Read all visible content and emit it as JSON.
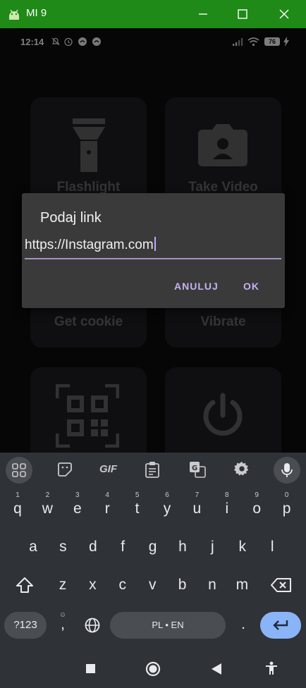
{
  "window": {
    "title": "MI 9"
  },
  "status": {
    "time": "12:14",
    "battery": "76"
  },
  "tiles": [
    {
      "label": "Flashlight",
      "icon": "flashlight-icon"
    },
    {
      "label": "Take Video",
      "icon": "camera-icon"
    },
    {
      "label": "Get cookie",
      "icon": "cookie-icon"
    },
    {
      "label": "Vibrate",
      "icon": "vibrate-icon"
    },
    {
      "label": "QR",
      "icon": "qr-code-icon"
    },
    {
      "label": "Turn off",
      "icon": "power-icon"
    }
  ],
  "dialog": {
    "title": "Podaj link",
    "input_value": "https://Instagram.com",
    "cancel_label": "ANULUJ",
    "ok_label": "OK"
  },
  "keyboard": {
    "toolbar": [
      "apps-grid-icon",
      "sticker-icon",
      "GIF",
      "clipboard-icon",
      "translate-icon",
      "gear-icon",
      "mic-icon"
    ],
    "row1": [
      {
        "k": "q",
        "h": "1"
      },
      {
        "k": "w",
        "h": "2"
      },
      {
        "k": "e",
        "h": "3"
      },
      {
        "k": "r",
        "h": "4"
      },
      {
        "k": "t",
        "h": "5"
      },
      {
        "k": "y",
        "h": "6"
      },
      {
        "k": "u",
        "h": "7"
      },
      {
        "k": "i",
        "h": "8"
      },
      {
        "k": "o",
        "h": "9"
      },
      {
        "k": "p",
        "h": "0"
      }
    ],
    "row2": [
      "a",
      "s",
      "d",
      "f",
      "g",
      "h",
      "j",
      "k",
      "l"
    ],
    "row3": [
      "z",
      "x",
      "c",
      "v",
      "b",
      "n",
      "m"
    ],
    "symbols_label": "?123",
    "comma": ",",
    "space_label": "PL • EN",
    "period": "."
  },
  "colors": {
    "titlebar": "#1f8a17",
    "accent": "#c4b2ee",
    "enter_key": "#8ab4f8"
  }
}
